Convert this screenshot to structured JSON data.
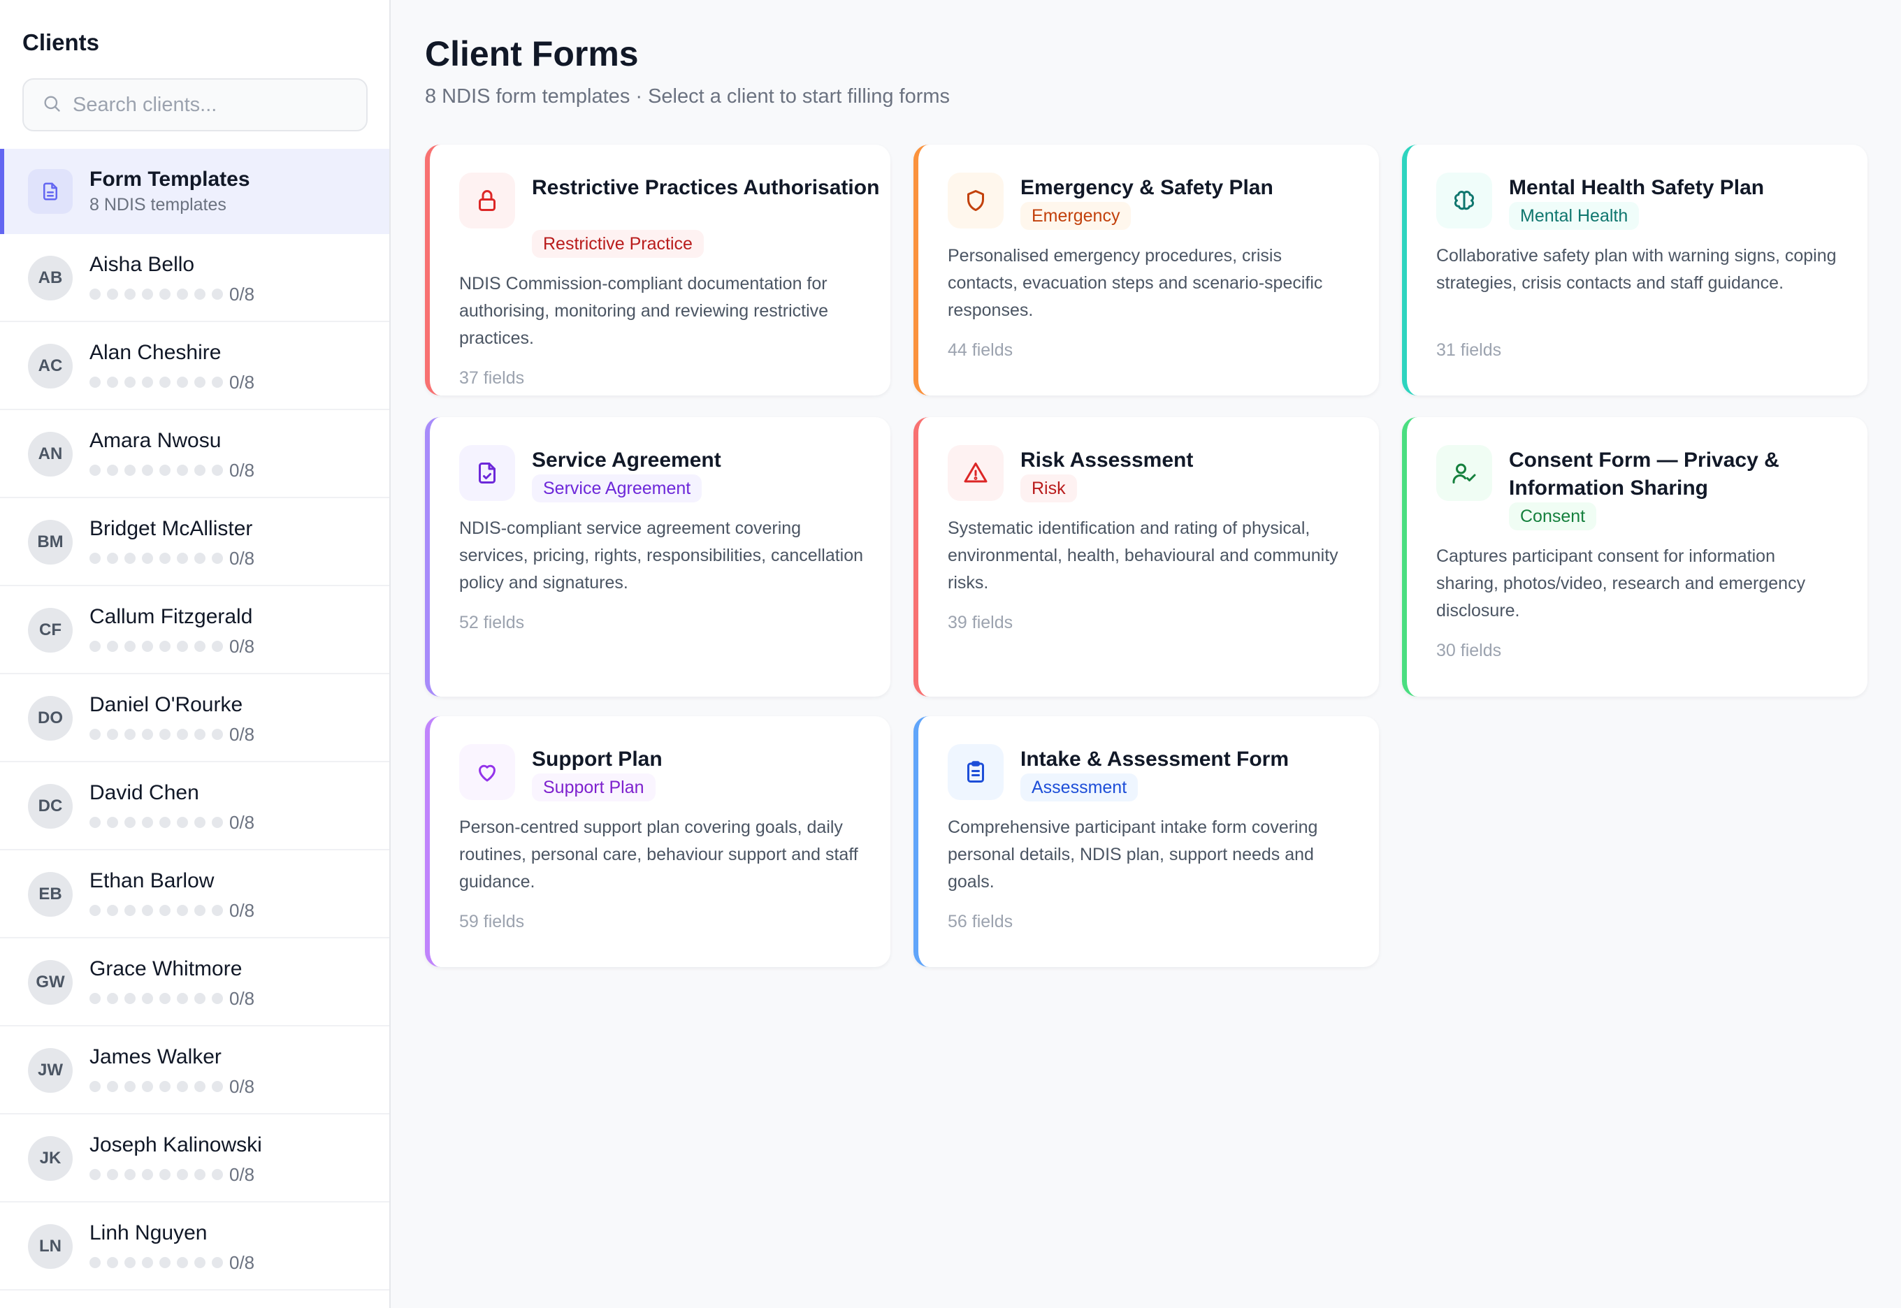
{
  "sidebar": {
    "title": "Clients",
    "search_placeholder": "Search clients...",
    "templates_item": {
      "label": "Form Templates",
      "sub": "8 NDIS templates"
    },
    "clients": [
      {
        "initials": "AB",
        "name": "Aisha Bello",
        "progress": "0/8"
      },
      {
        "initials": "AC",
        "name": "Alan Cheshire",
        "progress": "0/8"
      },
      {
        "initials": "AN",
        "name": "Amara Nwosu",
        "progress": "0/8"
      },
      {
        "initials": "BM",
        "name": "Bridget McAllister",
        "progress": "0/8"
      },
      {
        "initials": "CF",
        "name": "Callum Fitzgerald",
        "progress": "0/8"
      },
      {
        "initials": "DO",
        "name": "Daniel O'Rourke",
        "progress": "0/8"
      },
      {
        "initials": "DC",
        "name": "David Chen",
        "progress": "0/8"
      },
      {
        "initials": "EB",
        "name": "Ethan Barlow",
        "progress": "0/8"
      },
      {
        "initials": "GW",
        "name": "Grace Whitmore",
        "progress": "0/8"
      },
      {
        "initials": "JW",
        "name": "James Walker",
        "progress": "0/8"
      },
      {
        "initials": "JK",
        "name": "Joseph Kalinowski",
        "progress": "0/8"
      },
      {
        "initials": "LN",
        "name": "Linh Nguyen",
        "progress": "0/8"
      }
    ]
  },
  "main": {
    "title": "Client Forms",
    "subtitle": "8 NDIS form templates · Select a client to start filling forms",
    "cards": [
      {
        "title": "Restrictive Practices Authorisation",
        "badge": "Restrictive Practice",
        "description": "NDIS Commission-compliant documentation for authorising, monitoring and reviewing restrictive practices.",
        "fields": "37 fields",
        "icon": "lock-icon",
        "accent": "#f87171",
        "icon_bg": "#fef2f2",
        "icon_color": "#dc2626",
        "badge_bg": "#fef2f2",
        "badge_color": "#b91c1c"
      },
      {
        "title": "Emergency & Safety Plan",
        "badge": "Emergency",
        "description": "Personalised emergency procedures, crisis contacts, evacuation steps and scenario-specific responses.",
        "fields": "44 fields",
        "icon": "shield-icon",
        "accent": "#fb923c",
        "icon_bg": "#fff7ed",
        "icon_color": "#c2410c",
        "badge_bg": "#fff7ed",
        "badge_color": "#c2410c"
      },
      {
        "title": "Mental Health Safety Plan",
        "badge": "Mental Health",
        "description": "Collaborative safety plan with warning signs, coping strategies, crisis contacts and staff guidance.",
        "fields": "31 fields",
        "icon": "brain-icon",
        "accent": "#2dd4bf",
        "icon_bg": "#f0fdfa",
        "icon_color": "#0f766e",
        "badge_bg": "#f0fdfa",
        "badge_color": "#0f766e"
      },
      {
        "title": "Service Agreement",
        "badge": "Service Agreement",
        "description": "NDIS-compliant service agreement covering services, pricing, rights, responsibilities, cancellation policy and signatures.",
        "fields": "52 fields",
        "icon": "file-check-icon",
        "accent": "#a78bfa",
        "icon_bg": "#f5f3ff",
        "icon_color": "#6d28d9",
        "badge_bg": "#f5f3ff",
        "badge_color": "#6d28d9"
      },
      {
        "title": "Risk Assessment",
        "badge": "Risk",
        "description": "Systematic identification and rating of physical, environmental, health, behavioural and community risks.",
        "fields": "39 fields",
        "icon": "warning-triangle-icon",
        "accent": "#f87171",
        "icon_bg": "#fef2f2",
        "icon_color": "#dc2626",
        "badge_bg": "#fef2f2",
        "badge_color": "#b91c1c"
      },
      {
        "title": "Consent Form — Privacy & Information Sharing",
        "badge": "Consent",
        "description": "Captures participant consent for information sharing, photos/video, research and emergency disclosure.",
        "fields": "30 fields",
        "icon": "user-check-icon",
        "accent": "#4ade80",
        "icon_bg": "#f0fdf4",
        "icon_color": "#15803d",
        "badge_bg": "#f0fdf4",
        "badge_color": "#15803d"
      },
      {
        "title": "Support Plan",
        "badge": "Support Plan",
        "description": "Person-centred support plan covering goals, daily routines, personal care, behaviour support and staff guidance.",
        "fields": "59 fields",
        "icon": "heart-icon",
        "accent": "#c084fc",
        "icon_bg": "#faf5ff",
        "icon_color": "#9333ea",
        "badge_bg": "#faf5ff",
        "badge_color": "#7e22ce"
      },
      {
        "title": "Intake & Assessment Form",
        "badge": "Assessment",
        "description": "Comprehensive participant intake form covering personal details, NDIS plan, support needs and goals.",
        "fields": "56 fields",
        "icon": "clipboard-icon",
        "accent": "#60a5fa",
        "icon_bg": "#eff6ff",
        "icon_color": "#1d4ed8",
        "badge_bg": "#eff6ff",
        "badge_color": "#1d4ed8"
      }
    ]
  }
}
